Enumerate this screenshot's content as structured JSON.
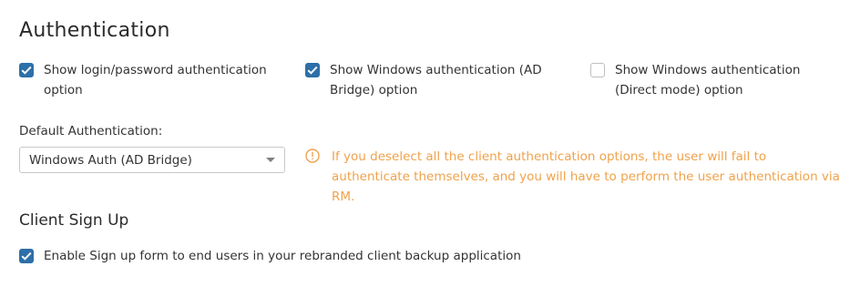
{
  "authentication": {
    "title": "Authentication",
    "options": [
      {
        "label": "Show login/password authentication option",
        "checked": true
      },
      {
        "label": "Show Windows authentication (AD Bridge) option",
        "checked": true
      },
      {
        "label": "Show Windows authentication (Direct mode) option",
        "checked": false
      }
    ],
    "default_label": "Default Authentication:",
    "default_value": "Windows Auth (AD Bridge)",
    "warning": "If you deselect all the client authentication options, the user will fail to authenticate themselves, and you will have to perform the user authentication via RM."
  },
  "client_signup": {
    "title": "Client Sign Up",
    "option_label": "Enable Sign up form to end users in your rebranded client backup application",
    "option_checked": true
  },
  "colors": {
    "accent": "#2d6fa8",
    "warning": "#f0a24b",
    "text": "#333333"
  },
  "icons": {
    "checked": "checkmark-icon",
    "warning": "info-circle-icon",
    "dropdown": "chevron-down-icon"
  }
}
